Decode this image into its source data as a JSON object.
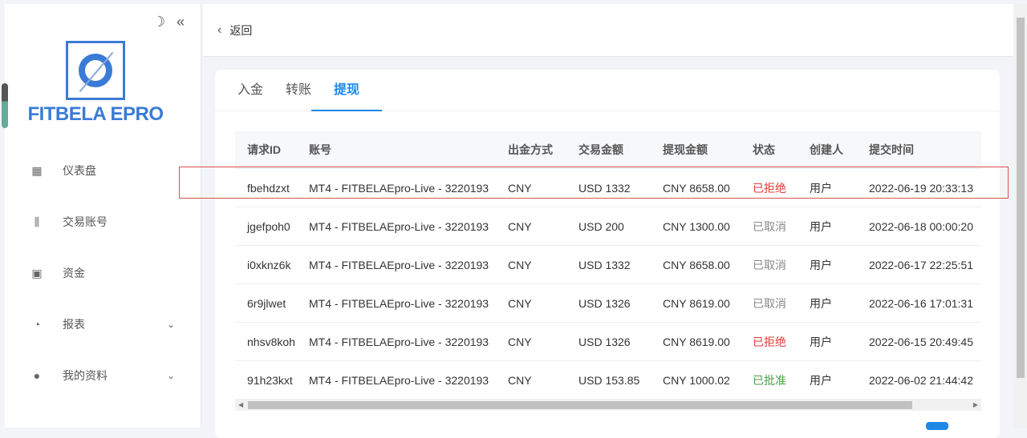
{
  "sidebar": {
    "brand": "FITBELA EPRO",
    "items": [
      {
        "label": "仪表盘",
        "icon": "dashboard-icon"
      },
      {
        "label": "交易账号",
        "icon": "trading-icon"
      },
      {
        "label": "资金",
        "icon": "wallet-icon"
      },
      {
        "label": "报表",
        "icon": "pie-chart-icon",
        "expandable": true
      },
      {
        "label": "我的资料",
        "icon": "user-icon",
        "expandable": true
      }
    ]
  },
  "header": {
    "back_label": "返回"
  },
  "tabs": [
    {
      "label": "入金"
    },
    {
      "label": "转账"
    },
    {
      "label": "提现",
      "active": true
    }
  ],
  "table": {
    "columns": [
      "请求ID",
      "账号",
      "出金方式",
      "交易金额",
      "提现金额",
      "状态",
      "创建人",
      "提交时间"
    ],
    "rows": [
      [
        "fbehdzxt",
        "MT4 - FITBELAEpro-Live - 3220193",
        "CNY",
        "USD 1332",
        "CNY 8658.00",
        "已拒绝",
        "用户",
        "2022-06-19 20:33:13"
      ],
      [
        "jgefpoh0",
        "MT4 - FITBELAEpro-Live - 3220193",
        "CNY",
        "USD 200",
        "CNY 1300.00",
        "已取消",
        "用户",
        "2022-06-18 00:00:20"
      ],
      [
        "i0xknz6k",
        "MT4 - FITBELAEpro-Live - 3220193",
        "CNY",
        "USD 1332",
        "CNY 8658.00",
        "已取消",
        "用户",
        "2022-06-17 22:25:51"
      ],
      [
        "6r9jlwet",
        "MT4 - FITBELAEpro-Live - 3220193",
        "CNY",
        "USD 1326",
        "CNY 8619.00",
        "已取消",
        "用户",
        "2022-06-16 17:01:31"
      ],
      [
        "nhsv8koh",
        "MT4 - FITBELAEpro-Live - 3220193",
        "CNY",
        "USD 1326",
        "CNY 8619.00",
        "已拒绝",
        "用户",
        "2022-06-15 20:49:45"
      ],
      [
        "91h23kxt",
        "MT4 - FITBELAEpro-Live - 3220193",
        "CNY",
        "USD 153.85",
        "CNY 1000.02",
        "已批准",
        "用户",
        "2022-06-02 21:44:42"
      ]
    ]
  },
  "status_colors": {
    "已拒绝": "#e53935",
    "已取消": "#888888",
    "已批准": "#43a047"
  }
}
